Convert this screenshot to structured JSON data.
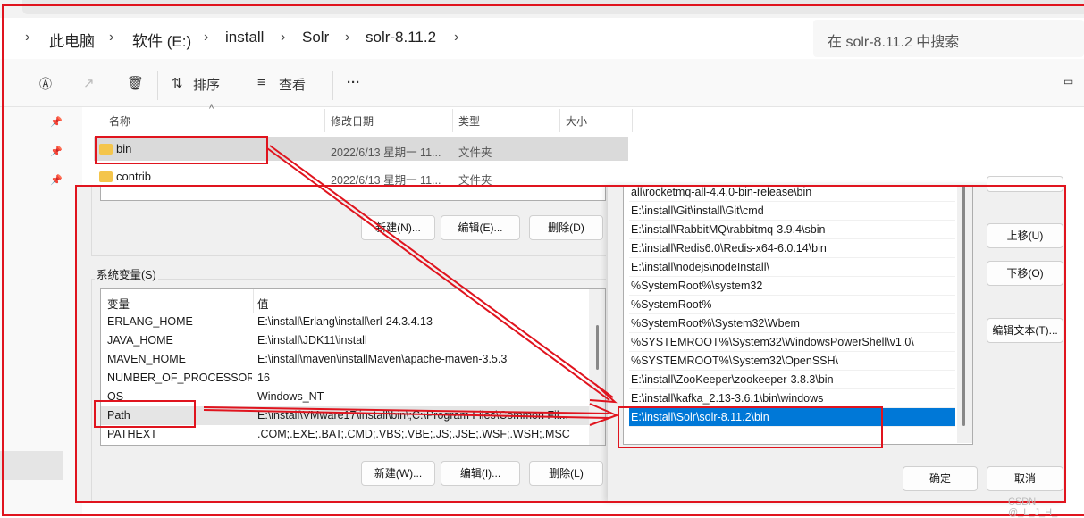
{
  "explorer": {
    "breadcrumb": [
      "此电脑",
      "软件 (E:)",
      "install",
      "Solr",
      "solr-8.11.2"
    ],
    "search_placeholder": "在 solr-8.11.2 中搜索",
    "toolbar": {
      "sort": "排序",
      "view": "查看",
      "more": "···"
    },
    "columns": [
      "名称",
      "修改日期",
      "类型",
      "大小"
    ],
    "files": [
      {
        "name": "bin",
        "date": "2022/6/13  星期一 11...",
        "type": "文件夹"
      },
      {
        "name": "contrib",
        "date": "2022/6/13  星期一 11...",
        "type": "文件夹"
      }
    ]
  },
  "env_dialog": {
    "user_buttons": [
      "新建(N)...",
      "编辑(E)...",
      "删除(D)"
    ],
    "system_group": "系统变量(S)",
    "headers": [
      "变量",
      "值"
    ],
    "rows": [
      [
        "ERLANG_HOME",
        "E:\\install\\Erlang\\install\\erl-24.3.4.13"
      ],
      [
        "JAVA_HOME",
        "E:\\install\\JDK11\\install"
      ],
      [
        "MAVEN_HOME",
        "E:\\install\\maven\\installMaven\\apache-maven-3.5.3"
      ],
      [
        "NUMBER_OF_PROCESSORS",
        "16"
      ],
      [
        "OS",
        "Windows_NT"
      ],
      [
        "Path",
        "E:\\install\\VMware17\\install\\bin\\;C:\\Program Files\\Common Fil..."
      ],
      [
        "PATHEXT",
        ".COM;.EXE;.BAT;.CMD;.VBS;.VBE;.JS;.JSE;.WSF;.WSH;.MSC"
      ]
    ],
    "system_buttons": [
      "新建(W)...",
      "编辑(I)...",
      "删除(L)"
    ]
  },
  "path_dialog": {
    "items": [
      "all\\rocketmq-all-4.4.0-bin-release\\bin",
      "E:\\install\\Git\\install\\Git\\cmd",
      "E:\\install\\RabbitMQ\\rabbitmq-3.9.4\\sbin",
      "E:\\install\\Redis6.0\\Redis-x64-6.0.14\\bin",
      "E:\\install\\nodejs\\nodeInstall\\",
      "%SystemRoot%\\system32",
      "%SystemRoot%",
      "%SystemRoot%\\System32\\Wbem",
      "%SYSTEMROOT%\\System32\\WindowsPowerShell\\v1.0\\",
      "%SYSTEMROOT%\\System32\\OpenSSH\\",
      "E:\\install\\ZooKeeper\\zookeeper-3.8.3\\bin",
      "E:\\install\\kafka_2.13-3.6.1\\bin\\windows",
      "E:\\install\\Solr\\solr-8.11.2\\bin"
    ],
    "selected_index": 12,
    "side_buttons": [
      "上移(U)",
      "下移(O)",
      "编辑文本(T)..."
    ],
    "ok": "确定",
    "cancel": "取消"
  },
  "watermark": "CSDN @_L_J_H_",
  "colors": {
    "selection": "#0078d7",
    "annotation": "#e0141e"
  }
}
